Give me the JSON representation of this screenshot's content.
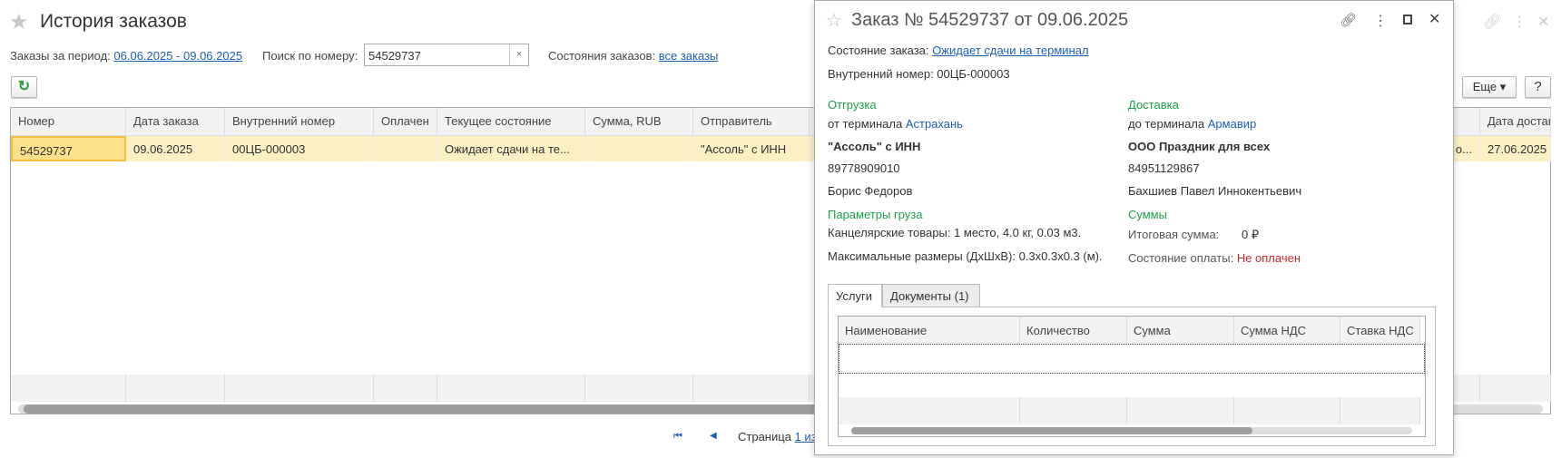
{
  "page": {
    "title": "История заказов",
    "period_label": "Заказы за период:",
    "period_value": "06.06.2025 - 09.06.2025",
    "search_label": "Поиск по номеру:",
    "search_value": "54529737",
    "clear": "×",
    "states_label": "Состояния заказов:",
    "states_value": "все заказы",
    "more_button": "Еще ▾",
    "help_button": "?",
    "refresh_icon": "↻"
  },
  "table": {
    "columns": [
      "Номер",
      "Дата заказа",
      "Внутренний номер",
      "Оплачен",
      "Текущее состояние",
      "Сумма, RUB",
      "Отправитель",
      "Дата доставки"
    ],
    "rows": [
      {
        "c0": "54529737",
        "c1": "09.06.2025",
        "c2": "00ЦБ-000003",
        "c3": "",
        "c4": "Ожидает сдачи на те...",
        "c5": "",
        "c6": "\"Ассоль\" с ИНН",
        "c7": "27.06.2025",
        "hidden_tail": "о..."
      }
    ]
  },
  "pager": {
    "first": "⏮",
    "prev": "◀",
    "label": "Страница",
    "page": "1 из"
  },
  "popup": {
    "title": "Заказ № 54529737 от 09.06.2025",
    "state_label": "Состояние заказа:",
    "state_value": "Ожидает сдачи на терминал",
    "internal": "Внутренний номер: 00ЦБ-000003",
    "ship_head": "Отгрузка",
    "ship_prefix": "от терминала",
    "ship_city": "Астрахань",
    "sender": "\"Ассоль\" с ИНН",
    "sender_phone": "89778909010",
    "sender_person": "Борис Федоров",
    "del_head": "Доставка",
    "del_prefix": "до терминала",
    "del_city": "Армавир",
    "receiver": "ООО Праздник для всех",
    "receiver_phone": "84951129867",
    "receiver_person": "Бахшиев Павел Иннокентьевич",
    "cargo_head": "Параметры груза",
    "cargo_line": "Канцелярские товары: 1 место, 4.0 кг, 0.03 м3.",
    "cargo_dims": "Максимальные размеры (ДхШхВ): 0.3x0.3x0.3 (м).",
    "sums_head": "Суммы",
    "total_label": "Итоговая сумма:",
    "total_value": "0 ₽",
    "pay_label": "Состояние оплаты:",
    "pay_value": "Не оплачен",
    "tabs": [
      "Услуги",
      "Документы (1)"
    ],
    "columns": [
      "Наименование",
      "Количество",
      "Сумма",
      "Сумма НДС",
      "Ставка НДС"
    ]
  },
  "colors": {
    "link": "#1a5fb4",
    "section": "#1d9e4b",
    "unpaid": "#c62828",
    "row_highlight": "#fbf0c3"
  }
}
